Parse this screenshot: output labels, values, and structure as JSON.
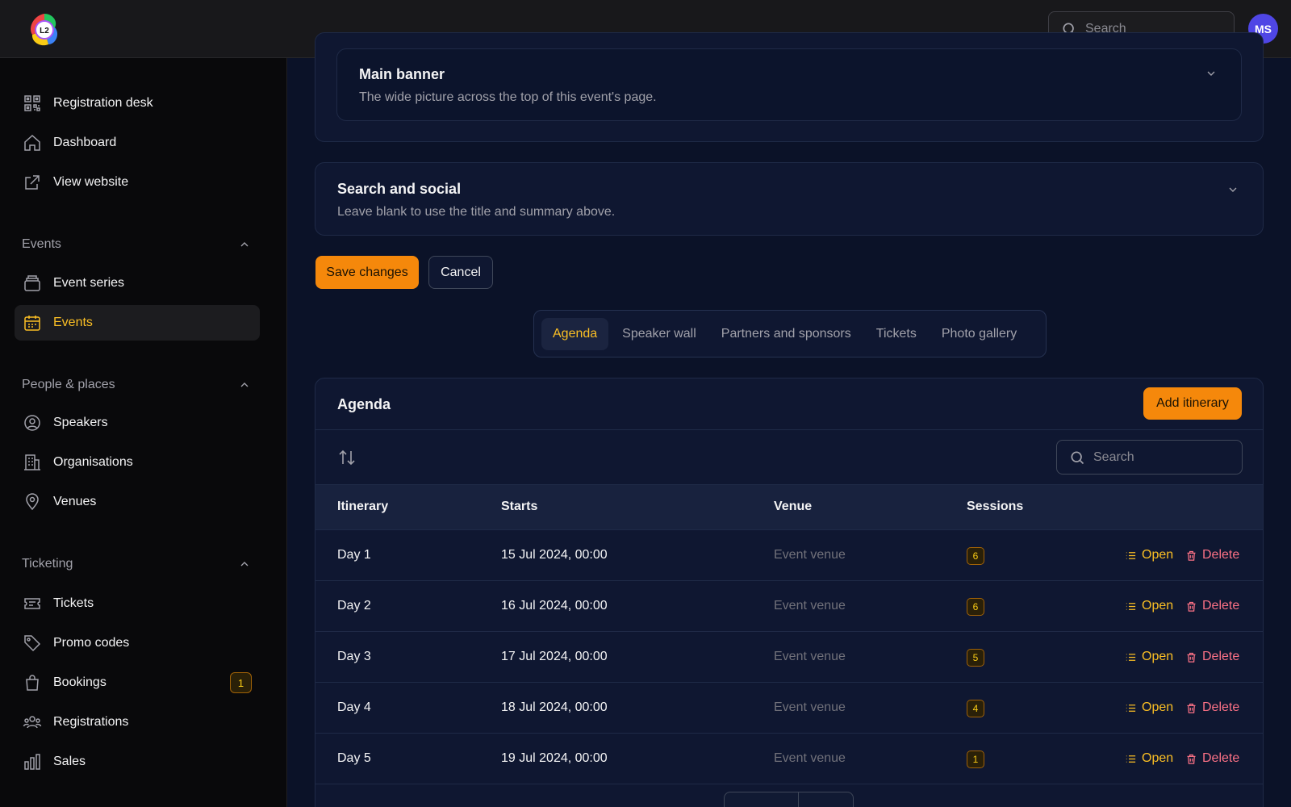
{
  "topbar": {
    "logo_text": "L2",
    "search_placeholder": "Search",
    "avatar_initials": "MS"
  },
  "sidebar": {
    "top_items": [
      {
        "label": "Registration desk",
        "icon": "qr-code-icon"
      },
      {
        "label": "Dashboard",
        "icon": "home-icon"
      },
      {
        "label": "View website",
        "icon": "external-link-icon"
      }
    ],
    "sections": [
      {
        "title": "Events",
        "items": [
          {
            "label": "Event series",
            "icon": "stack-icon"
          },
          {
            "label": "Events",
            "icon": "calendar-icon",
            "active": true
          }
        ]
      },
      {
        "title": "People & places",
        "items": [
          {
            "label": "Speakers",
            "icon": "user-circle-icon"
          },
          {
            "label": "Organisations",
            "icon": "building-icon"
          },
          {
            "label": "Venues",
            "icon": "map-pin-icon"
          }
        ]
      },
      {
        "title": "Ticketing",
        "items": [
          {
            "label": "Tickets",
            "icon": "ticket-icon"
          },
          {
            "label": "Promo codes",
            "icon": "tag-icon"
          },
          {
            "label": "Bookings",
            "icon": "shopping-bag-icon",
            "badge": "1"
          },
          {
            "label": "Registrations",
            "icon": "users-icon"
          },
          {
            "label": "Sales",
            "icon": "bar-chart-icon"
          }
        ]
      }
    ]
  },
  "main_banner": {
    "title": "Main banner",
    "subtitle": "The wide picture across the top of this event's page."
  },
  "search_social": {
    "title": "Search and social",
    "subtitle": "Leave blank to use the title and summary above."
  },
  "actions": {
    "save_label": "Save changes",
    "cancel_label": "Cancel"
  },
  "tabs": [
    "Agenda",
    "Speaker wall",
    "Partners and sponsors",
    "Tickets",
    "Photo gallery"
  ],
  "agenda": {
    "title": "Agenda",
    "add_label": "Add itinerary",
    "search_placeholder": "Search",
    "columns": [
      "Itinerary",
      "Starts",
      "Venue",
      "Sessions"
    ],
    "rows": [
      {
        "itinerary": "Day 1",
        "starts": "15 Jul 2024, 00:00",
        "venue": "Event venue",
        "sessions": "6"
      },
      {
        "itinerary": "Day 2",
        "starts": "16 Jul 2024, 00:00",
        "venue": "Event venue",
        "sessions": "6"
      },
      {
        "itinerary": "Day 3",
        "starts": "17 Jul 2024, 00:00",
        "venue": "Event venue",
        "sessions": "5"
      },
      {
        "itinerary": "Day 4",
        "starts": "18 Jul 2024, 00:00",
        "venue": "Event venue",
        "sessions": "4"
      },
      {
        "itinerary": "Day 5",
        "starts": "19 Jul 2024, 00:00",
        "venue": "Event venue",
        "sessions": "1"
      }
    ],
    "open_label": "Open",
    "delete_label": "Delete"
  },
  "colors": {
    "accent": "#f5880b",
    "active_text": "#fbbf24",
    "danger": "#fb7185",
    "background": "#0b1228",
    "sidebar": "#09090b"
  }
}
